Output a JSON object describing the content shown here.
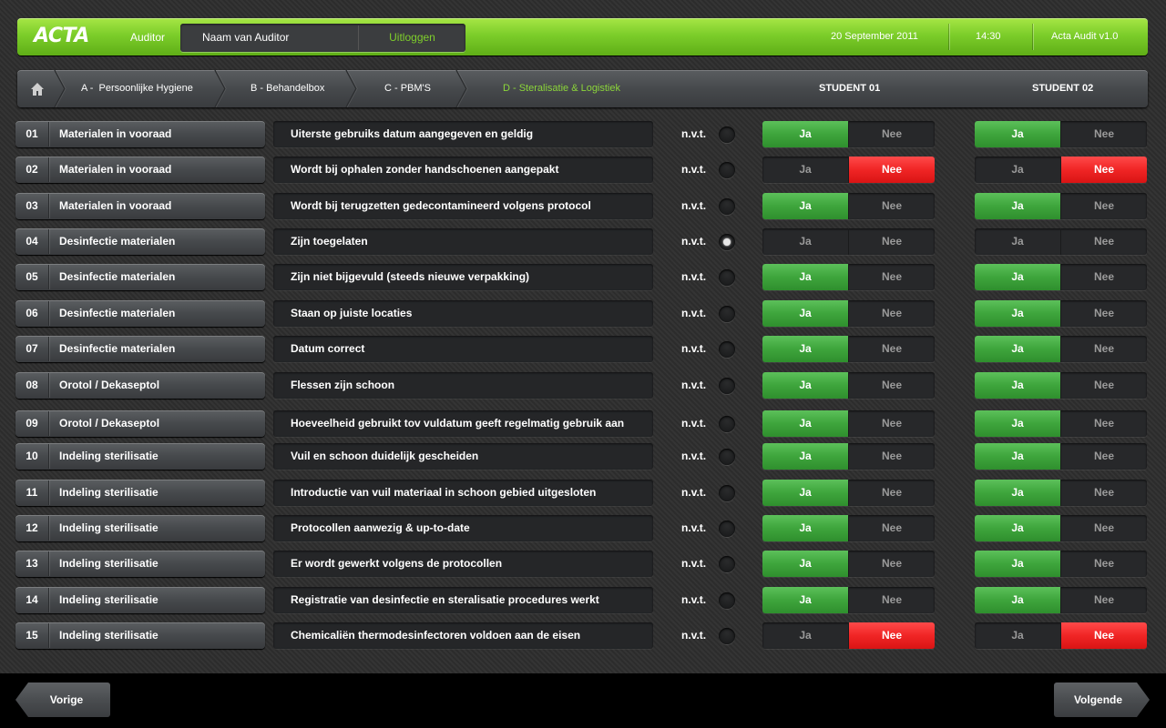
{
  "header": {
    "logo": "ACTA",
    "auditor_label": "Auditor",
    "auditor_name": "Naam van Auditor",
    "logout_label": "Uitloggen",
    "date": "20 September 2011",
    "time": "14:30",
    "version": "Acta Audit v1.0"
  },
  "nav": {
    "home_icon": "home-icon",
    "tabs": [
      {
        "label": "A -  Persoonlijke Hygiene",
        "active": false
      },
      {
        "label": "B - Behandelbox",
        "active": false
      },
      {
        "label": "C - PBM'S",
        "active": false
      },
      {
        "label": "D - Steralisatie & Logistiek",
        "active": true
      }
    ],
    "student1": "STUDENT 01",
    "student2": "STUDENT 02"
  },
  "labels": {
    "nvt": "n.v.t.",
    "ja": "Ja",
    "nee": "Nee"
  },
  "rows": [
    {
      "num": "01",
      "category": "Materialen in vooraad",
      "question": "Uiterste gebruiks datum aangegeven en geldig",
      "nvt": false,
      "s1": "ja",
      "s2": "ja"
    },
    {
      "num": "02",
      "category": "Materialen in vooraad",
      "question": "Wordt bij ophalen zonder handschoenen aangepakt",
      "nvt": false,
      "s1": "nee",
      "s2": "nee"
    },
    {
      "num": "03",
      "category": "Materialen in vooraad",
      "question": "Wordt bij terugzetten gedecontamineerd volgens protocol",
      "nvt": false,
      "s1": "ja",
      "s2": "ja"
    },
    {
      "num": "04",
      "category": "Desinfectie materialen",
      "question": "Zijn toegelaten",
      "nvt": true,
      "s1": "",
      "s2": ""
    },
    {
      "num": "05",
      "category": "Desinfectie materialen",
      "question": "Zijn niet bijgevuld (steeds nieuwe verpakking)",
      "nvt": false,
      "s1": "ja",
      "s2": "ja"
    },
    {
      "num": "06",
      "category": "Desinfectie materialen",
      "question": "Staan op juiste locaties",
      "nvt": false,
      "s1": "ja",
      "s2": "ja"
    },
    {
      "num": "07",
      "category": "Desinfectie materialen",
      "question": "Datum correct",
      "nvt": false,
      "s1": "ja",
      "s2": "ja"
    },
    {
      "num": "08",
      "category": "Orotol / Dekaseptol",
      "question": "Flessen zijn schoon",
      "nvt": false,
      "s1": "ja",
      "s2": "ja"
    },
    {
      "num": "09",
      "category": "Orotol / Dekaseptol",
      "question": "Hoeveelheid gebruikt tov vuldatum geeft regelmatig gebruik aan",
      "nvt": false,
      "s1": "ja",
      "s2": "ja"
    },
    {
      "num": "10",
      "category": "Indeling sterilisatie",
      "question": "Vuil en schoon duidelijk gescheiden",
      "nvt": false,
      "s1": "ja",
      "s2": "ja"
    },
    {
      "num": "11",
      "category": "Indeling sterilisatie",
      "question": "Introductie van vuil materiaal in schoon gebied uitgesloten",
      "nvt": false,
      "s1": "ja",
      "s2": "ja"
    },
    {
      "num": "12",
      "category": "Indeling sterilisatie",
      "question": "Protocollen aanwezig & up-to-date",
      "nvt": false,
      "s1": "ja",
      "s2": "ja"
    },
    {
      "num": "13",
      "category": "Indeling sterilisatie",
      "question": "Er wordt gewerkt volgens de protocollen",
      "nvt": false,
      "s1": "ja",
      "s2": "ja"
    },
    {
      "num": "14",
      "category": "Indeling sterilisatie",
      "question": "Registratie van desinfectie en steralisatie procedures werkt",
      "nvt": false,
      "s1": "ja",
      "s2": "ja"
    },
    {
      "num": "15",
      "category": "Indeling sterilisatie",
      "question": "Chemicaliën thermodesinfectoren voldoen aan de eisen",
      "nvt": false,
      "s1": "nee",
      "s2": "nee"
    }
  ],
  "footer": {
    "prev_label": "Vorige",
    "next_label": "Volgende"
  },
  "colors": {
    "accent_green": "#7ccd2a",
    "ja_green": "#3ea53c",
    "nee_red": "#f02525"
  }
}
